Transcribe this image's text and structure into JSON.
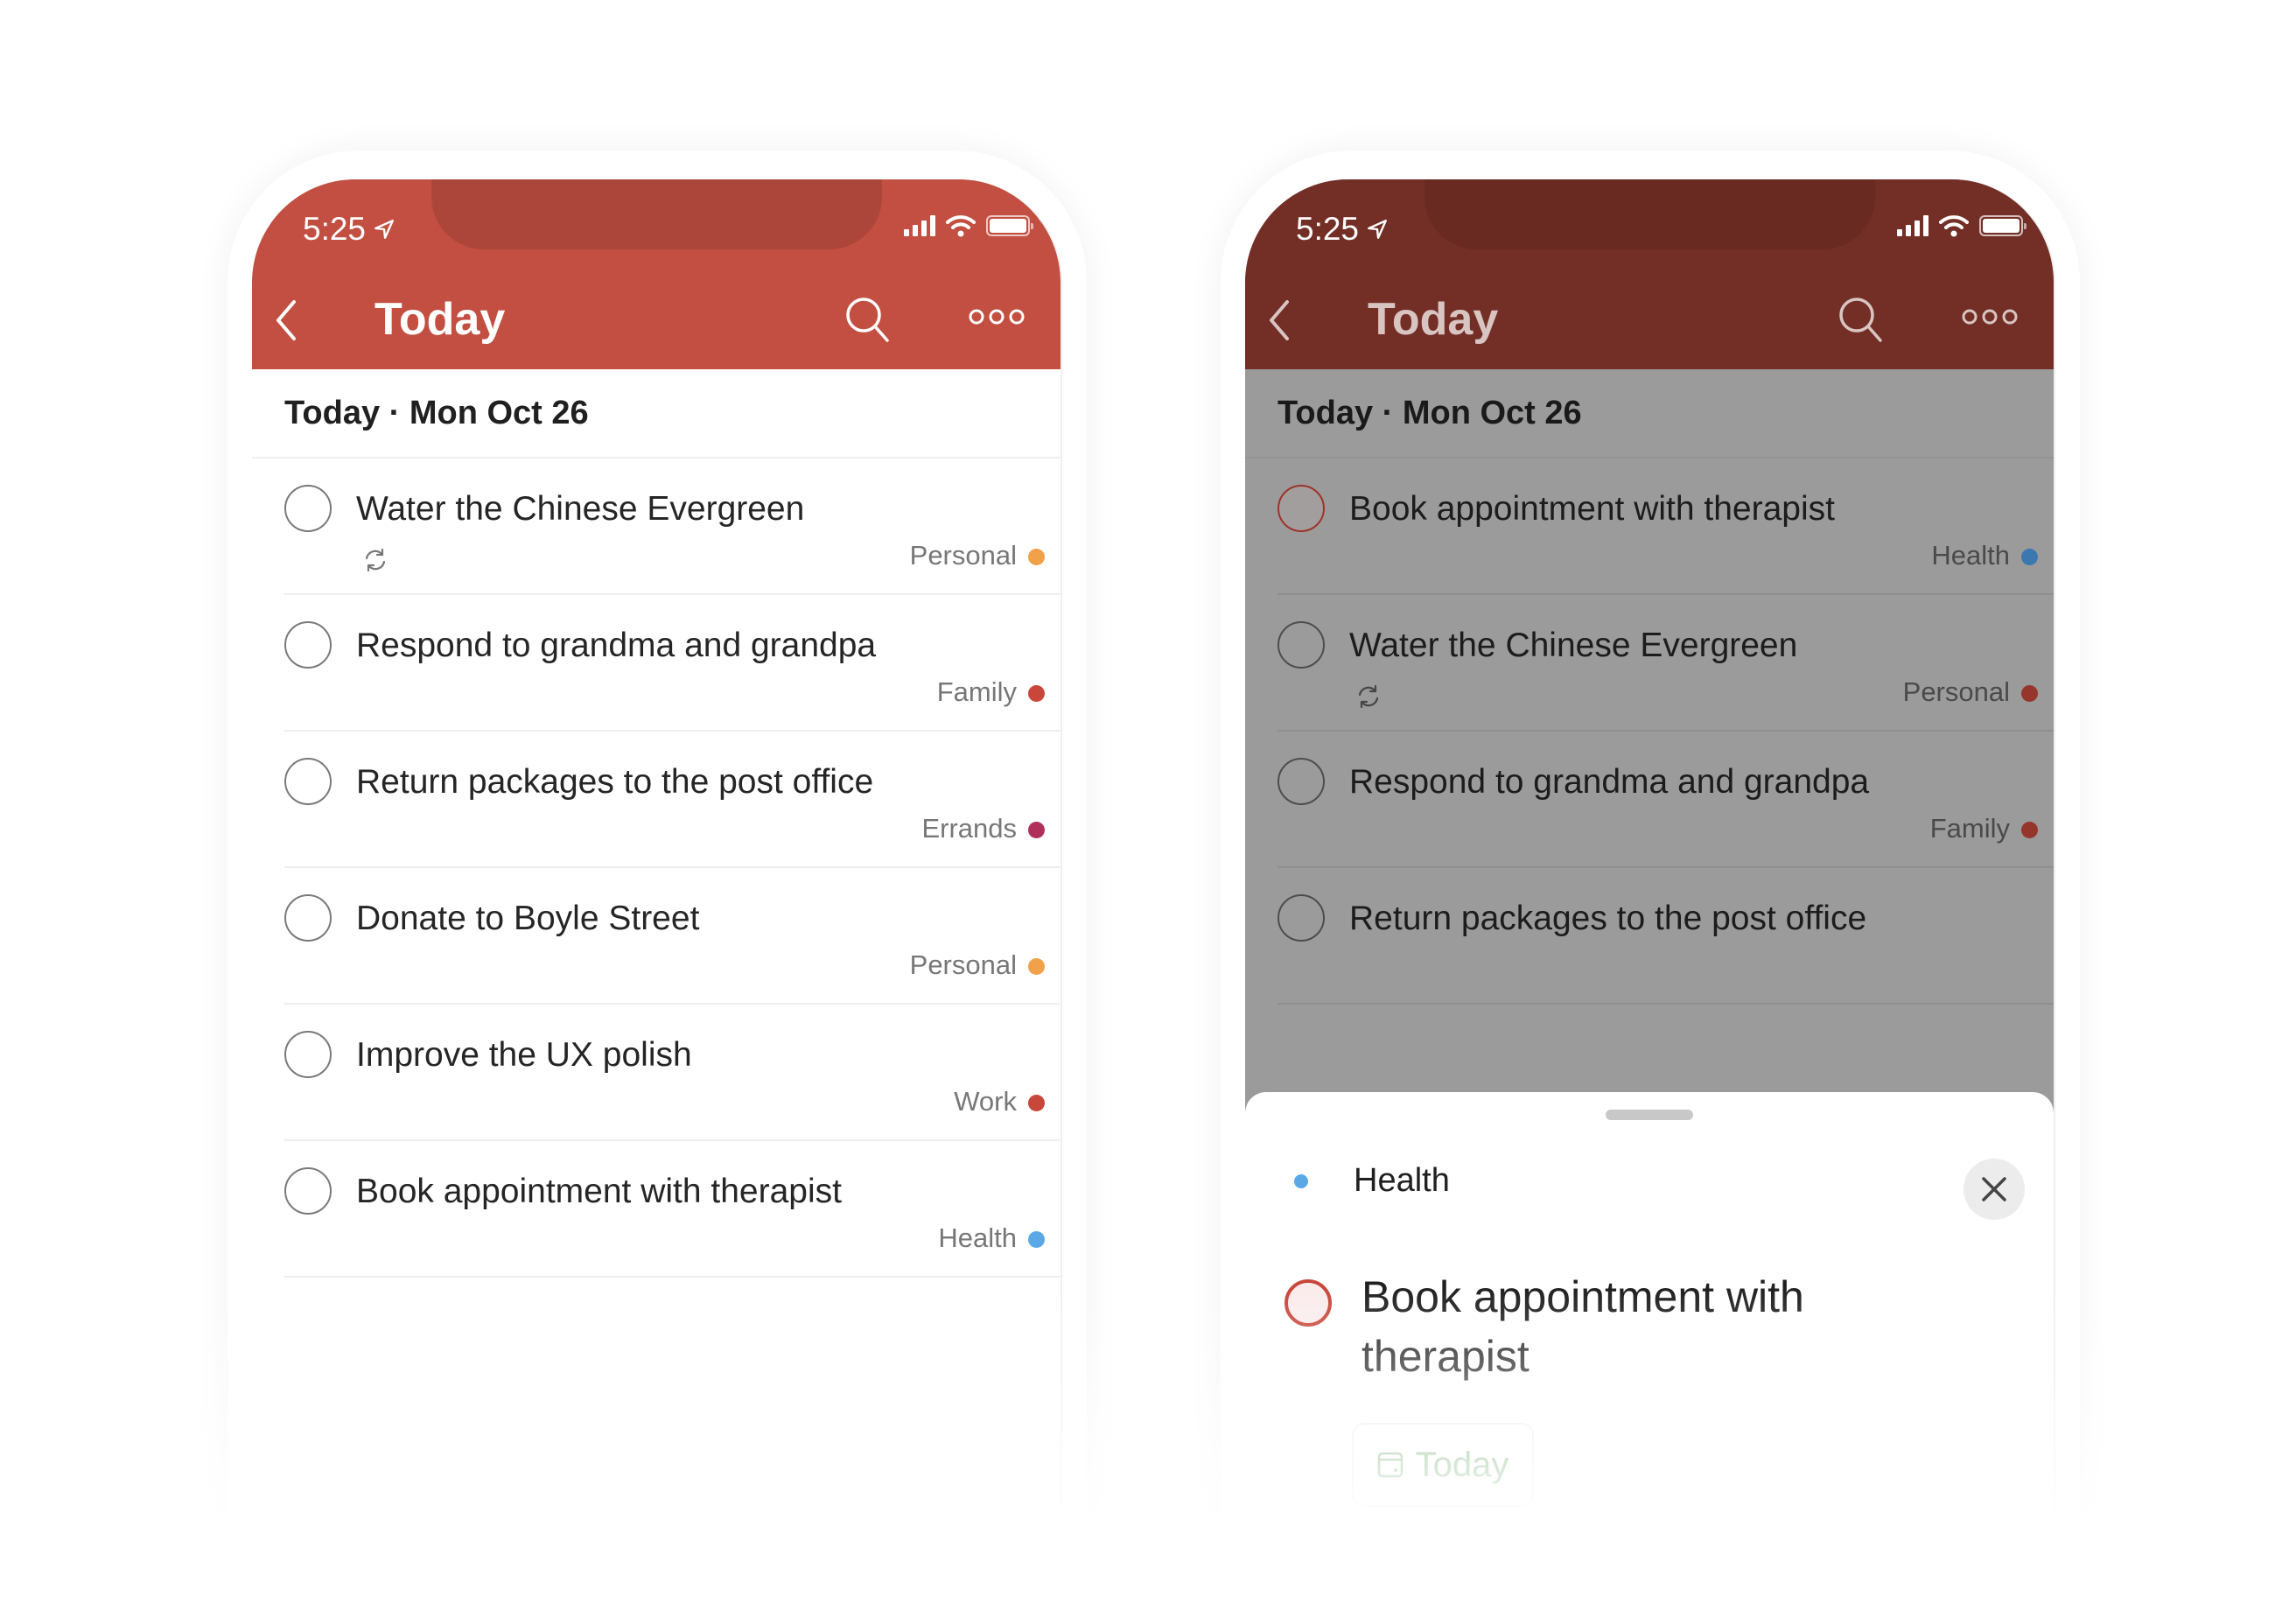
{
  "status_bar": {
    "time": "5:25"
  },
  "colors": {
    "brand": "#c24f41",
    "brand_dimmed": "#732e26",
    "personal": "#f0a14a",
    "family": "#c8473a",
    "errands": "#b0305a",
    "work": "#c8473a",
    "health": "#5aa9e6",
    "date_chip": "#6aaa6a"
  },
  "left_phone": {
    "header": {
      "title": "Today"
    },
    "section_header": "Today · Mon Oct 26",
    "tasks": [
      {
        "title": "Water the Chinese Evergreen",
        "project": "Personal",
        "recurring": true
      },
      {
        "title": "Respond to grandma and grandpa",
        "project": "Family",
        "recurring": false
      },
      {
        "title": "Return packages to the post office",
        "project": "Errands",
        "recurring": false
      },
      {
        "title": "Donate to Boyle Street",
        "project": "Personal",
        "recurring": false
      },
      {
        "title": "Improve the UX polish",
        "project": "Work",
        "recurring": false
      },
      {
        "title": "Book appointment with therapist",
        "project": "Health",
        "recurring": false
      }
    ]
  },
  "right_phone": {
    "header": {
      "title": "Today"
    },
    "section_header": "Today · Mon Oct 26",
    "tasks": [
      {
        "title": "Book appointment with therapist",
        "project": "Health",
        "recurring": false,
        "selected": true
      },
      {
        "title": "Water the Chinese Evergreen",
        "project": "Personal",
        "recurring": true
      },
      {
        "title": "Respond to grandma and grandpa",
        "project": "Family",
        "recurring": false
      },
      {
        "title": "Return packages to the post office",
        "project": "",
        "recurring": false
      }
    ],
    "task_sheet": {
      "project": "Health",
      "task_title": "Book appointment with therapist",
      "due_date": "Today",
      "actions": [
        "label-icon",
        "priority-flag-icon",
        "reminder-icon",
        "comment-icon",
        "more-icon"
      ]
    }
  }
}
